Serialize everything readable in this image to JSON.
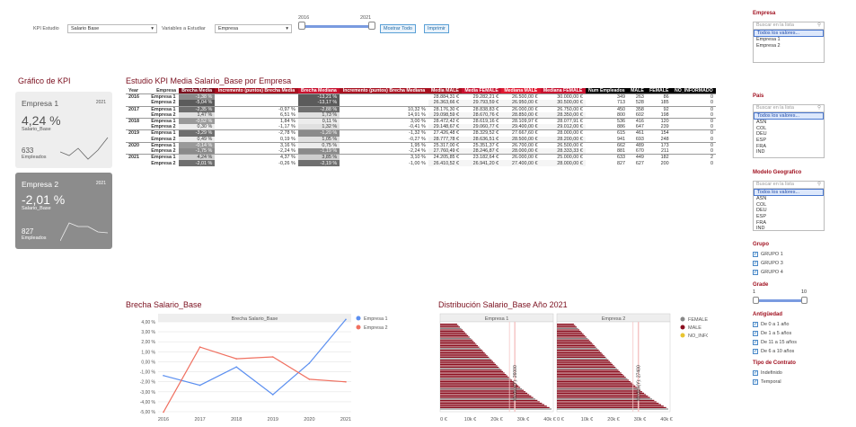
{
  "filters": {
    "kpi_label": "KPI Estudio",
    "kpi_value": "Salario Base",
    "var_label": "Variables a Estudiar",
    "var_value": "Empresa",
    "year_min": "2016",
    "year_max": "2021",
    "btn_show": "Mostrar Todo",
    "btn_print": "Imprimir"
  },
  "kpi_panel": {
    "title": "Gráfico de KPI",
    "cards": [
      {
        "name": "Empresa 1",
        "year": "2021",
        "value": "4,24 %",
        "metric": "Salario_Base",
        "count": "633",
        "count_label": "Empleados"
      },
      {
        "name": "Empresa 2",
        "year": "2021",
        "value": "-2,01 %",
        "metric": "Salario_Base",
        "count": "827",
        "count_label": "Empleados"
      }
    ]
  },
  "table": {
    "title": "Estudio KPI Media Salario_Base por Empresa",
    "headers": [
      "Year",
      "Empresa",
      "Brecha Media",
      "Incremento (puntos) Brecha Media",
      "Brecha Mediana",
      "Incremento (puntos) Brecha Mediana",
      "Media MALE",
      "Media FEMALE",
      "Mediana MALE",
      "Mediana FEMALE",
      "Num Empleados",
      "MALE",
      "FEMALE",
      "NO_INFORMADO"
    ],
    "rows": [
      [
        "2016",
        "Empresa 1",
        "-1,38 %",
        "",
        "-13,21 %",
        "",
        "28.884,31 €",
        "29.282,21 €",
        "26.500,00 €",
        "30.000,00 €",
        "349",
        "263",
        "86",
        "0"
      ],
      [
        "",
        "Empresa 2",
        "-5,04 %",
        "",
        "-13,17 %",
        "",
        "26.363,66 €",
        "29.793,59 €",
        "26.950,00 €",
        "30.500,00 €",
        "713",
        "528",
        "185",
        "0"
      ],
      [
        "2017",
        "Empresa 1",
        "-2,35 %",
        "-0,97 %",
        "-2,88 %",
        "10,32 %",
        "28.176,30 €",
        "28.838,83 €",
        "26.000,00 €",
        "26.750,00 €",
        "450",
        "358",
        "92",
        "0"
      ],
      [
        "",
        "Empresa 2",
        "1,47 %",
        "6,51 %",
        "1,73 %",
        "14,91 %",
        "29.098,59 €",
        "28.670,76 €",
        "28.850,00 €",
        "28.350,00 €",
        "800",
        "602",
        "198",
        "0"
      ],
      [
        "2018",
        "Empresa 1",
        "-0,52 %",
        "1,84 %",
        "0,11 %",
        "3,00 %",
        "28.472,42 €",
        "28.619,16 €",
        "28.109,97 €",
        "28.077,91 €",
        "536",
        "416",
        "120",
        "0"
      ],
      [
        "",
        "Empresa 2",
        "0,30 %",
        "-1,17 %",
        "1,32 %",
        "-0,41 %",
        "29.148,67 €",
        "29.060,77 €",
        "29.400,00 €",
        "29.012,00 €",
        "886",
        "647",
        "239",
        "0"
      ],
      [
        "2019",
        "Empresa 1",
        "-3,29 %",
        "-2,78 %",
        "-1,20 %",
        "-1,32 %",
        "27.426,48 €",
        "28.329,52 €",
        "27.667,60 €",
        "28.000,00 €",
        "615",
        "461",
        "154",
        "0"
      ],
      [
        "",
        "Empresa 2",
        "0,49 %",
        "0,19 %",
        "1,05 %",
        "-0,27 %",
        "28.777,78 €",
        "28.636,51 €",
        "28.500,00 €",
        "28.200,00 €",
        "941",
        "693",
        "248",
        "0"
      ],
      [
        "2020",
        "Empresa 1",
        "-0,14 %",
        "3,16 %",
        "0,75 %",
        "1,95 %",
        "25.317,00 €",
        "25.351,37 €",
        "26.700,00 €",
        "26.500,00 €",
        "662",
        "489",
        "173",
        "0"
      ],
      [
        "",
        "Empresa 2",
        "-1,75 %",
        "-2,24 %",
        "-1,19 %",
        "-2,24 %",
        "27.760,49 €",
        "28.246,87 €",
        "28.000,00 €",
        "28.333,33 €",
        "881",
        "670",
        "211",
        "0"
      ],
      [
        "2021",
        "Empresa 1",
        "4,24 %",
        "4,37 %",
        "3,85 %",
        "3,10 %",
        "24.205,85 €",
        "23.182,64 €",
        "26.000,00 €",
        "25.000,00 €",
        "633",
        "449",
        "182",
        "2"
      ],
      [
        "",
        "Empresa 2",
        "-2,01 %",
        "-0,26 %",
        "-2,19 %",
        "-1,00 %",
        "26.410,52 €",
        "26.941,20 €",
        "27.400,00 €",
        "28.000,00 €",
        "827",
        "627",
        "200",
        "0"
      ]
    ]
  },
  "line_section": {
    "title": "Brecha Salario_Base"
  },
  "chart_data": [
    {
      "type": "line",
      "title": "Brecha Salario_Base",
      "x": [
        2016,
        2017,
        2018,
        2019,
        2020,
        2021
      ],
      "series": [
        {
          "name": "Empresa 1",
          "color": "#5b8ff0",
          "values": [
            -1.38,
            -2.35,
            -0.52,
            -3.29,
            -0.14,
            4.24
          ]
        },
        {
          "name": "Empresa 2",
          "color": "#f07060",
          "values": [
            -5.04,
            1.47,
            0.3,
            0.49,
            -1.75,
            -2.01
          ]
        }
      ],
      "ylim": [
        -5,
        4
      ],
      "yticks": [
        "4,00 %",
        "3,00 %",
        "2,00 %",
        "1,00 %",
        "0,00 %",
        "-1,00 %",
        "-2,00 %",
        "-3,00 %",
        "-4,00 %",
        "-5,00 %"
      ],
      "xticks": [
        "2016",
        "2017",
        "2018",
        "2019",
        "2020",
        "2021"
      ],
      "legend": "top-right",
      "grid": true
    },
    {
      "type": "bar",
      "title": "Distribución Salario_Base Año 2021",
      "panels": [
        "Empresa 1",
        "Empresa 2"
      ],
      "xticks": [
        "0 €",
        "10k €",
        "20k €",
        "30k €",
        "40k €"
      ],
      "legend": [
        {
          "name": "FEMALE",
          "color": "#888888"
        },
        {
          "name": "MALE",
          "color": "#8b0f1f"
        },
        {
          "name": "NO_INFORMADO",
          "color": "#e8c530"
        }
      ],
      "median_labels": [
        "Median(Y): 26000",
        "Median(Y): 27400"
      ]
    }
  ],
  "dist_section": {
    "title": "Distribución Salario_Base Año 2021"
  },
  "sidebar": {
    "empresa": {
      "title": "Empresa",
      "search": "Buscar en la lista",
      "items": [
        "Todos los valores...",
        "Empresa 1",
        "Empresa 2"
      ]
    },
    "pais": {
      "title": "País",
      "search": "Buscar en la lista",
      "items": [
        "Todos los valores...",
        "ASN",
        "COL",
        "DEU",
        "ESP",
        "FRA",
        "IND"
      ]
    },
    "modelo": {
      "title": "Modelo Geografico",
      "search": "Buscar en la lista",
      "items": [
        "Todos los valores...",
        "ASN",
        "COL",
        "DEU",
        "ESP",
        "FRA",
        "IND"
      ]
    },
    "grupo": {
      "title": "Grupo",
      "items": [
        "GRUPO 1",
        "GRUPO 3",
        "GRUPO 4"
      ]
    },
    "grado": {
      "title": "Grade",
      "min": "1",
      "max": "10"
    },
    "antiguedad": {
      "title": "Antigüedad",
      "items": [
        "De 0 a 1 año",
        "De 1 a 5 años",
        "De 11 a 15 años",
        "De 6 a 10 años"
      ]
    },
    "contrato": {
      "title": "Tipo de Contrato",
      "items": [
        "Indefinido",
        "Temporal"
      ]
    }
  }
}
